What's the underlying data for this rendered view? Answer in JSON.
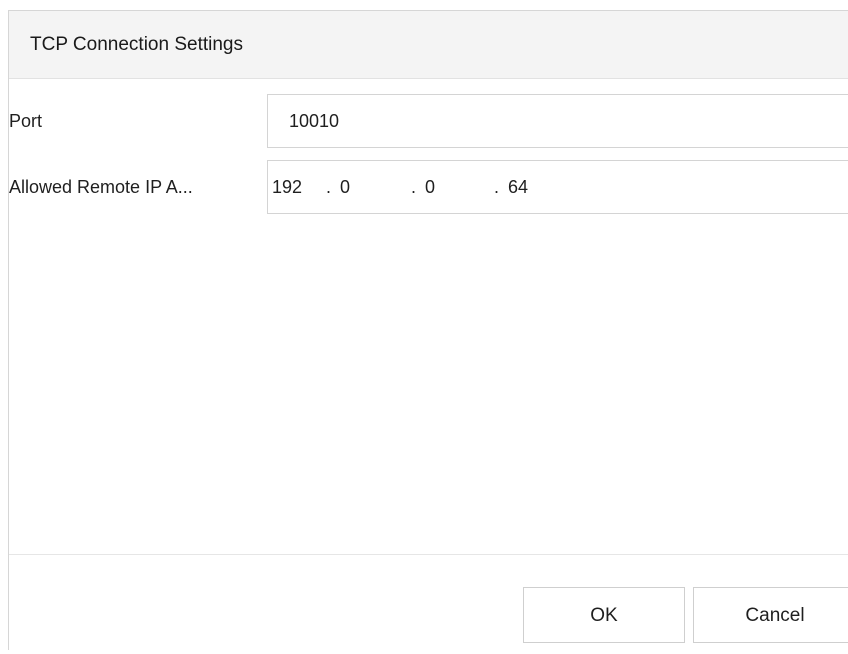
{
  "dialog": {
    "title": "TCP Connection Settings"
  },
  "form": {
    "port": {
      "label": "Port",
      "value": "10010"
    },
    "allowed_ip": {
      "label": "Allowed Remote IP A...",
      "segments": [
        "192",
        "0",
        "0",
        "64"
      ],
      "separator": "."
    }
  },
  "footer": {
    "ok_label": "OK",
    "cancel_label": "Cancel"
  }
}
